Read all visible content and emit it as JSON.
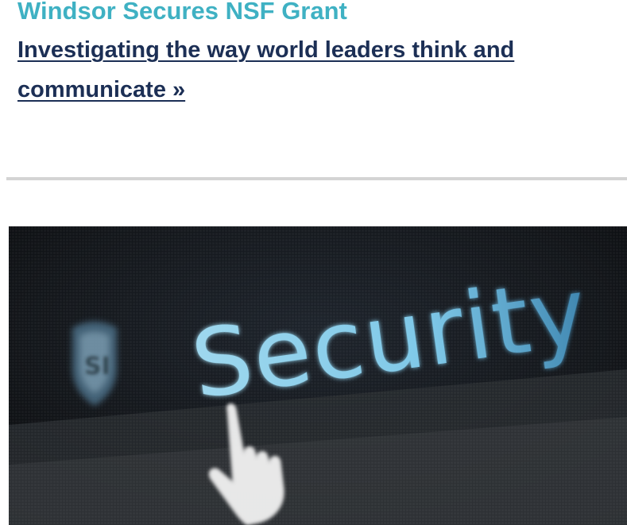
{
  "article": {
    "headline": "Windsor Secures NSF Grant",
    "link_text": "Investigating the way world leaders think and communicate »"
  },
  "hero_image": {
    "screen_word": "Security",
    "badge_text": "SI",
    "cursor_icon": "hand-pointer-icon",
    "colors": {
      "headline": "#3fb1c3",
      "link": "#1c2f55",
      "divider": "#d4d4d4",
      "screen_glow": "#8fd3ef"
    }
  }
}
